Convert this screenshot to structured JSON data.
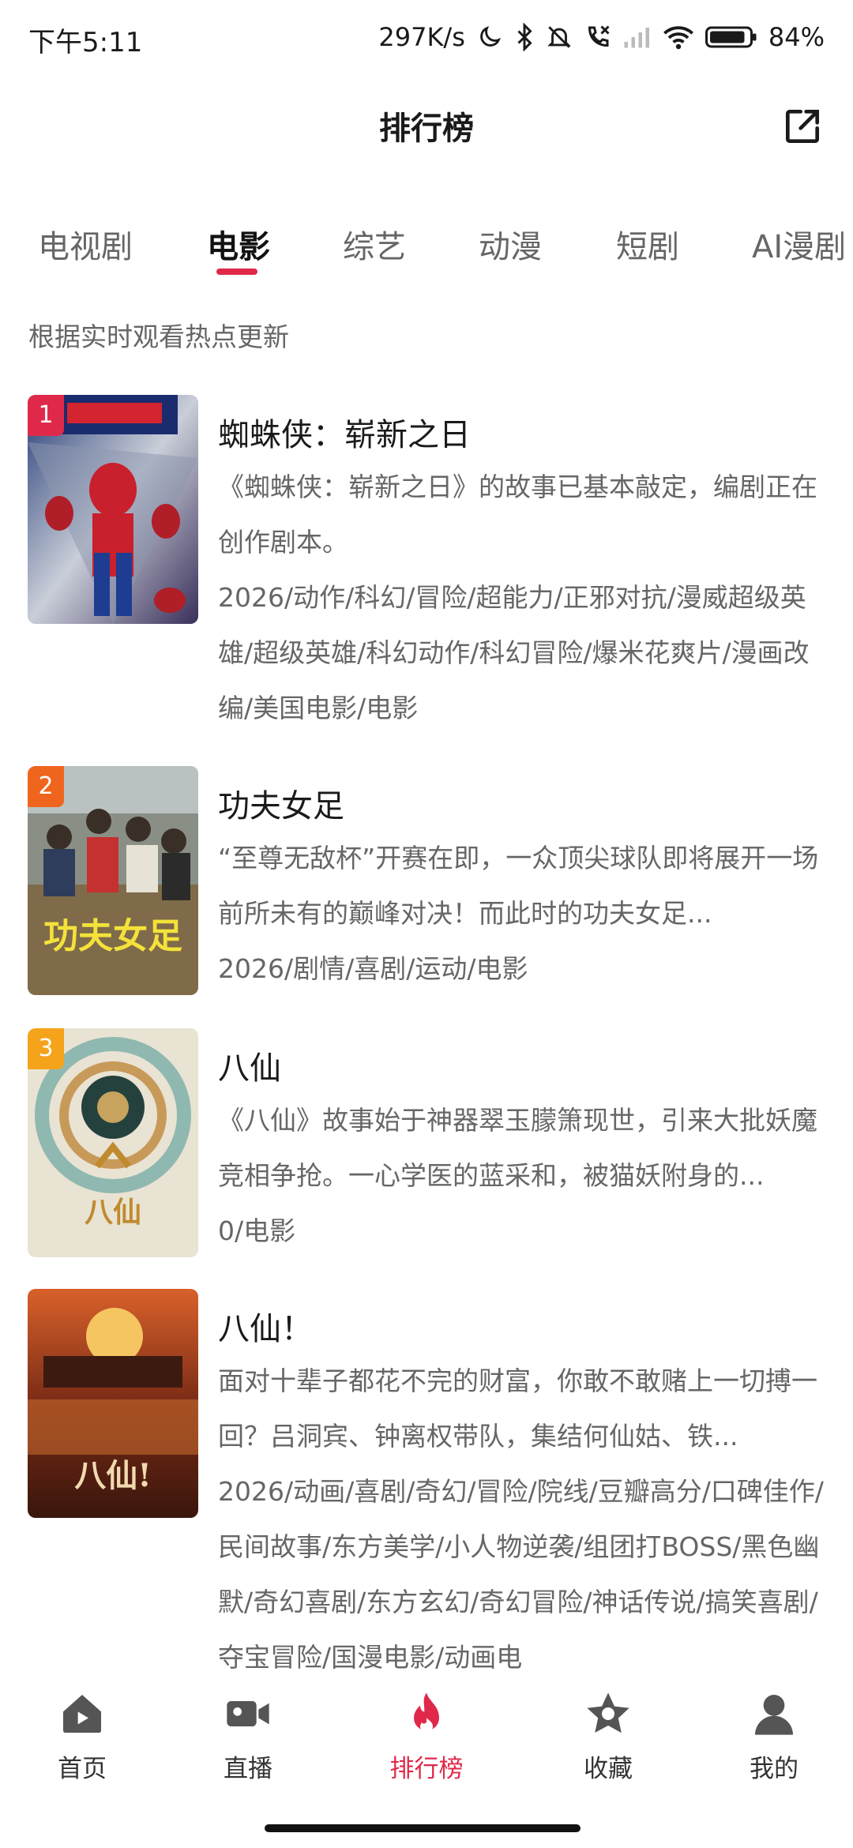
{
  "status_bar": {
    "time": "下午5:11",
    "speed": "297K/s",
    "battery": "84%",
    "icons": [
      "moon-icon",
      "bluetooth-icon",
      "mute-icon",
      "call-icon",
      "signal-icon",
      "wifi-icon",
      "battery-icon"
    ]
  },
  "header": {
    "title": "排行榜",
    "share_icon": "share-icon"
  },
  "tabs": [
    {
      "label": "电视剧",
      "active": false
    },
    {
      "label": "电影",
      "active": true
    },
    {
      "label": "综艺",
      "active": false
    },
    {
      "label": "动漫",
      "active": false
    },
    {
      "label": "短剧",
      "active": false
    },
    {
      "label": "AI漫剧",
      "active": false
    }
  ],
  "subtitle": "根据实时观看热点更新",
  "items": [
    {
      "rank": "1",
      "title": "蜘蛛侠：崭新之日",
      "desc": "《蜘蛛侠：崭新之日》的故事已基本敲定，编剧正在创作剧本。",
      "tags": "2026/动作/科幻/冒险/超能力/正邪对抗/漫威超级英雄/超级英雄/科幻动作/科幻冒险/爆米花爽片/漫画改编/美国电影/电影",
      "rank_color": "#e0294a"
    },
    {
      "rank": "2",
      "title": "功夫女足",
      "desc": "“至尊无敌杯”开赛在即，一众顶尖球队即将展开一场前所未有的巅峰对决！而此时的功夫女足...",
      "tags": "2026/剧情/喜剧/运动/电影",
      "rank_color": "#f0651e"
    },
    {
      "rank": "3",
      "title": "八仙",
      "desc": "《八仙》故事始于神器翠玉朦箫现世，引来大批妖魔竞相争抢。一心学医的蓝采和，被猫妖附身的...",
      "tags": "0/电影",
      "rank_color": "#f5a31a"
    },
    {
      "rank": "",
      "title": "八仙！",
      "desc": "面对十辈子都花不完的财富，你敢不敢赌上一切搏一回？吕洞宾、钟离权带队，集结何仙姑、铁...",
      "tags": "2026/动画/喜剧/奇幻/冒险/院线/豆瓣高分/口碑佳作/民间故事/东方美学/小人物逆袭/组团打BOSS/黑色幽默/奇幻喜剧/东方玄幻/奇幻冒险/神话传说/搞笑喜剧/夺宝冒险/国漫电影/动画电",
      "rank_color": ""
    }
  ],
  "bottom_nav": [
    {
      "label": "首页",
      "icon": "home-icon",
      "active": false
    },
    {
      "label": "直播",
      "icon": "video-camera-icon",
      "active": false
    },
    {
      "label": "排行榜",
      "icon": "flame-icon",
      "active": true
    },
    {
      "label": "收藏",
      "icon": "star-icon",
      "active": false
    },
    {
      "label": "我的",
      "icon": "user-icon",
      "active": false
    }
  ],
  "colors": {
    "accent": "#e0294a"
  }
}
